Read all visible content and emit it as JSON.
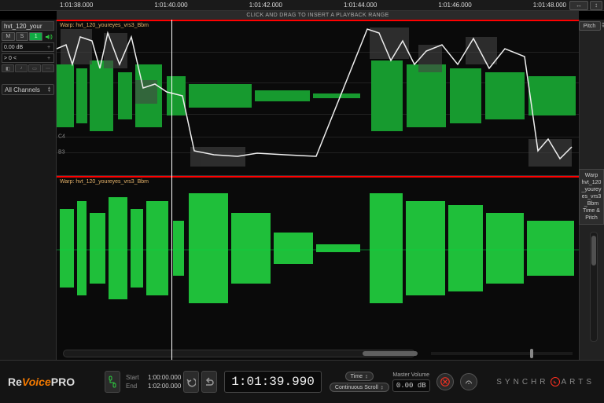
{
  "timeline": {
    "times": [
      "1:01:38.000",
      "1:01:40.000",
      "1:01:42.000",
      "1:01:44.000",
      "1:01:46.000",
      "1:01:48.000"
    ],
    "hint": "CLICK AND DRAG TO INSERT A PLAYBACK RANGE",
    "pitch_label": "Pitch"
  },
  "track": {
    "name": "hvt_120_your",
    "mute": "M",
    "solo": "S",
    "arm": "1",
    "gain": "0.00 dB",
    "pan": "> 0 <",
    "all_channels": "All Channels"
  },
  "lanes": {
    "clip1": "Warp: hvt_120_youreyes_vrs3_Bbm",
    "clip2": "Warp: hvt_120_youreyes_vrs3_Bbm",
    "notes": [
      {
        "label": "C4",
        "pos": 75
      },
      {
        "label": "B3",
        "pos": 85
      }
    ]
  },
  "process_panel": {
    "title": "Warp",
    "clip": "hvt_120_youreyes_vrs3_Bbm",
    "module": "Time & Pitch"
  },
  "transport": {
    "start_label": "Start",
    "end_label": "End",
    "start": "1:00:00.000",
    "end": "1:02:00.000",
    "position": "1:01:39.990",
    "time_mode_label": "Time",
    "time_mode": "—",
    "scroll_label": "Continuous Scroll",
    "master_label": "Master Volume",
    "master_db": "0.00 dB"
  },
  "brand": {
    "re": "Re",
    "voice": "Voice",
    "pro": "PRO",
    "company1": "SYNCHR",
    "company2": "ARTS"
  }
}
